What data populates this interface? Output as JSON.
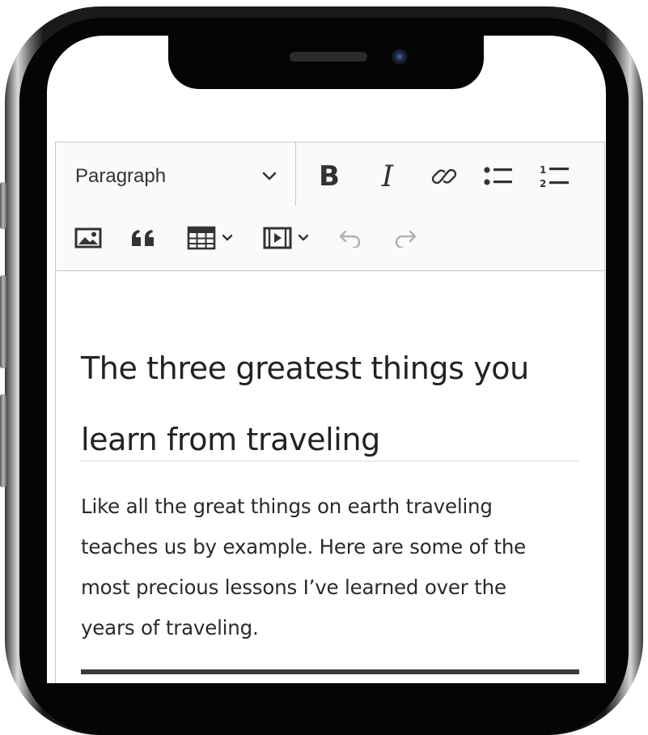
{
  "toolbar": {
    "heading_select": {
      "value": "Paragraph",
      "icon": "chevron-down-icon"
    },
    "row1": [
      {
        "name": "bold-button",
        "icon": "bold-icon",
        "glyph": "B"
      },
      {
        "name": "italic-button",
        "icon": "italic-icon",
        "glyph": "I"
      },
      {
        "name": "link-button",
        "icon": "link-icon"
      },
      {
        "name": "bulleted-list-button",
        "icon": "bulleted-list-icon"
      },
      {
        "name": "numbered-list-button",
        "icon": "numbered-list-icon"
      }
    ],
    "row2": [
      {
        "name": "insert-image-button",
        "icon": "image-icon"
      },
      {
        "name": "block-quote-button",
        "icon": "quote-icon"
      },
      {
        "name": "insert-table-button",
        "icon": "table-icon"
      },
      {
        "name": "insert-media-button",
        "icon": "media-icon"
      },
      {
        "name": "undo-button",
        "icon": "undo-icon"
      },
      {
        "name": "redo-button",
        "icon": "redo-icon"
      }
    ],
    "numbered_list_digits": [
      "1",
      "2"
    ]
  },
  "document": {
    "title_line1": "The three greatest things you",
    "title_line2": "learn from traveling",
    "paragraph_lines": [
      "Like all the great things on earth traveling",
      "teaches us by example. Here are some of the",
      "most precious lessons I’ve learned over the",
      "years of traveling."
    ]
  },
  "colors": {
    "toolbar_bg": "#fafafa",
    "border": "#c7c7c7",
    "icon": "#333333",
    "disabled_icon": "#b0b0b0",
    "text": "#222222"
  }
}
